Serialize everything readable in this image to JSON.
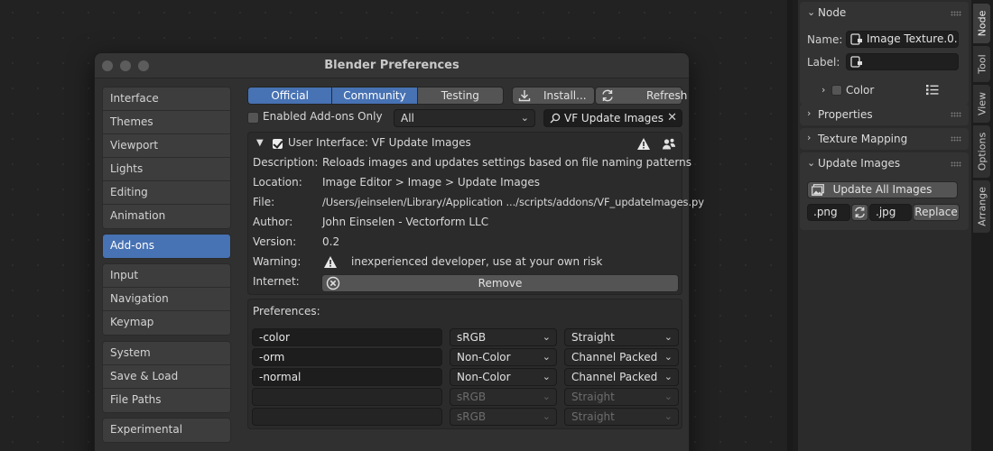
{
  "window": {
    "title": "Blender Preferences"
  },
  "nav": {
    "group1": [
      "Interface",
      "Themes",
      "Viewport",
      "Lights",
      "Editing",
      "Animation"
    ],
    "active": "Add-ons",
    "group2": [
      "Input",
      "Navigation",
      "Keymap"
    ],
    "group3": [
      "System",
      "Save & Load",
      "File Paths"
    ],
    "group4": [
      "Experimental"
    ]
  },
  "tabs": {
    "official": "Official",
    "community": "Community",
    "testing": "Testing"
  },
  "toolbar": {
    "install": "Install...",
    "refresh": "Refresh"
  },
  "filter": {
    "enabled_only": "Enabled Add-ons Only",
    "category": "All",
    "search": "VF Update Images"
  },
  "addon": {
    "title": "User Interface: VF Update Images",
    "rows": {
      "description": {
        "label": "Description:",
        "value": "Reloads images and updates settings based on file naming patterns"
      },
      "location": {
        "label": "Location:",
        "value": "Image Editor > Image > Update Images"
      },
      "file": {
        "label": "File:",
        "value": "/Users/jeinselen/Library/Application .../scripts/addons/VF_updateImages.py"
      },
      "author": {
        "label": "Author:",
        "value": "John Einselen - Vectorform LLC"
      },
      "version": {
        "label": "Version:",
        "value": "0.2"
      },
      "warning": {
        "label": "Warning:",
        "value": "inexperienced developer, use at your own risk"
      },
      "internet": {
        "label": "Internet:",
        "value": "Remove"
      }
    }
  },
  "preferences": {
    "label": "Preferences:",
    "rows": [
      {
        "suffix": "-color",
        "colorspace": "sRGB",
        "alpha": "Straight",
        "enabled": true
      },
      {
        "suffix": "-orm",
        "colorspace": "Non-Color",
        "alpha": "Channel Packed",
        "enabled": true
      },
      {
        "suffix": "-normal",
        "colorspace": "Non-Color",
        "alpha": "Channel Packed",
        "enabled": true
      },
      {
        "suffix": "",
        "colorspace": "sRGB",
        "alpha": "Straight",
        "enabled": false
      },
      {
        "suffix": "",
        "colorspace": "sRGB",
        "alpha": "Straight",
        "enabled": false
      }
    ]
  },
  "side": {
    "node": {
      "header": "Node",
      "name_label": "Name:",
      "name_value": "Image Texture.0...",
      "label_label": "Label:",
      "label_value": "",
      "color": "Color"
    },
    "properties": "Properties",
    "texture_mapping": "Texture Mapping",
    "update_images": {
      "header": "Update Images",
      "button": "Update All Images",
      "from": ".png",
      "to": ".jpg",
      "replace": "Replace"
    },
    "vtabs": [
      "Node",
      "Tool",
      "View",
      "Options",
      "Arrange"
    ]
  },
  "colors": {
    "accent": "#4772b3",
    "background": "#222222",
    "panel": "#303030"
  }
}
